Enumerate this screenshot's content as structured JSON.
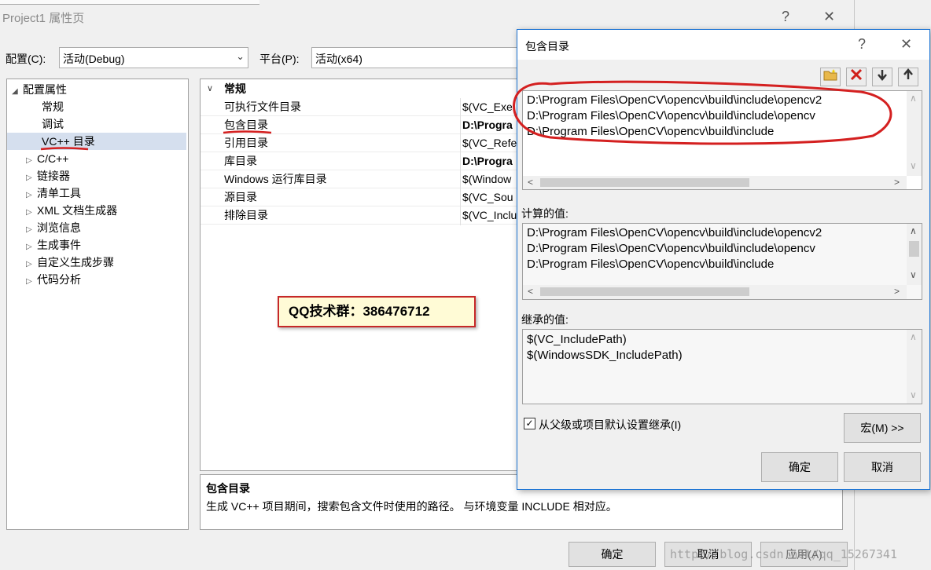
{
  "main_window": {
    "title": "Project1 属性页",
    "help_btn": "?",
    "close_btn": "✕",
    "config_label": "配置(C):",
    "config_value": "活动(Debug)",
    "platform_label": "平台(P):",
    "platform_value": "活动(x64)"
  },
  "tree": {
    "root": "配置属性",
    "items": [
      {
        "label": "常规"
      },
      {
        "label": "调试"
      },
      {
        "label": "VC++ 目录"
      },
      {
        "label": "C/C++"
      },
      {
        "label": "链接器"
      },
      {
        "label": "清单工具"
      },
      {
        "label": "XML 文档生成器"
      },
      {
        "label": "浏览信息"
      },
      {
        "label": "生成事件"
      },
      {
        "label": "自定义生成步骤"
      },
      {
        "label": "代码分析"
      }
    ]
  },
  "grid": {
    "section": "常规",
    "rows": [
      {
        "name": "可执行文件目录",
        "value": "$(VC_Exe"
      },
      {
        "name": "包含目录",
        "value": "D:\\Progra"
      },
      {
        "name": "引用目录",
        "value": "$(VC_Refe"
      },
      {
        "name": "库目录",
        "value": "D:\\Progra"
      },
      {
        "name": "Windows 运行库目录",
        "value": "$(Window"
      },
      {
        "name": "源目录",
        "value": "$(VC_Sou"
      },
      {
        "name": "排除目录",
        "value": "$(VC_Inclu"
      }
    ]
  },
  "description": {
    "title": "包含目录",
    "text": "生成 VC++ 项目期间，搜索包含文件时使用的路径。 与环境变量 INCLUDE 相对应。"
  },
  "qq_note": "QQ技术群：386476712",
  "bottom_buttons": {
    "ok": "确定",
    "cancel": "取消",
    "apply": "应用(A)"
  },
  "watermark": "http://blog.csdn.net/qq_15267341",
  "dialog": {
    "title": "包含目录",
    "help_btn": "?",
    "close_btn": "✕",
    "toolbar": {
      "new_folder": "new-folder-icon",
      "delete": "delete-icon",
      "move_down": "down-arrow-icon",
      "move_up": "up-arrow-icon"
    },
    "paths": [
      "D:\\Program Files\\OpenCV\\opencv\\build\\include\\opencv2",
      "D:\\Program Files\\OpenCV\\opencv\\build\\include\\opencv",
      "D:\\Program Files\\OpenCV\\opencv\\build\\include"
    ],
    "computed_label": "计算的值:",
    "computed": [
      "D:\\Program Files\\OpenCV\\opencv\\build\\include\\opencv2",
      "D:\\Program Files\\OpenCV\\opencv\\build\\include\\opencv",
      "D:\\Program Files\\OpenCV\\opencv\\build\\include"
    ],
    "inherited_label": "继承的值:",
    "inherited": [
      "$(VC_IncludePath)",
      "$(WindowsSDK_IncludePath)"
    ],
    "inherit_checkbox": "从父级或项目默认设置继承(I)",
    "inherit_checked": true,
    "macro_btn": "宏(M) >>",
    "ok": "确定",
    "cancel": "取消"
  }
}
